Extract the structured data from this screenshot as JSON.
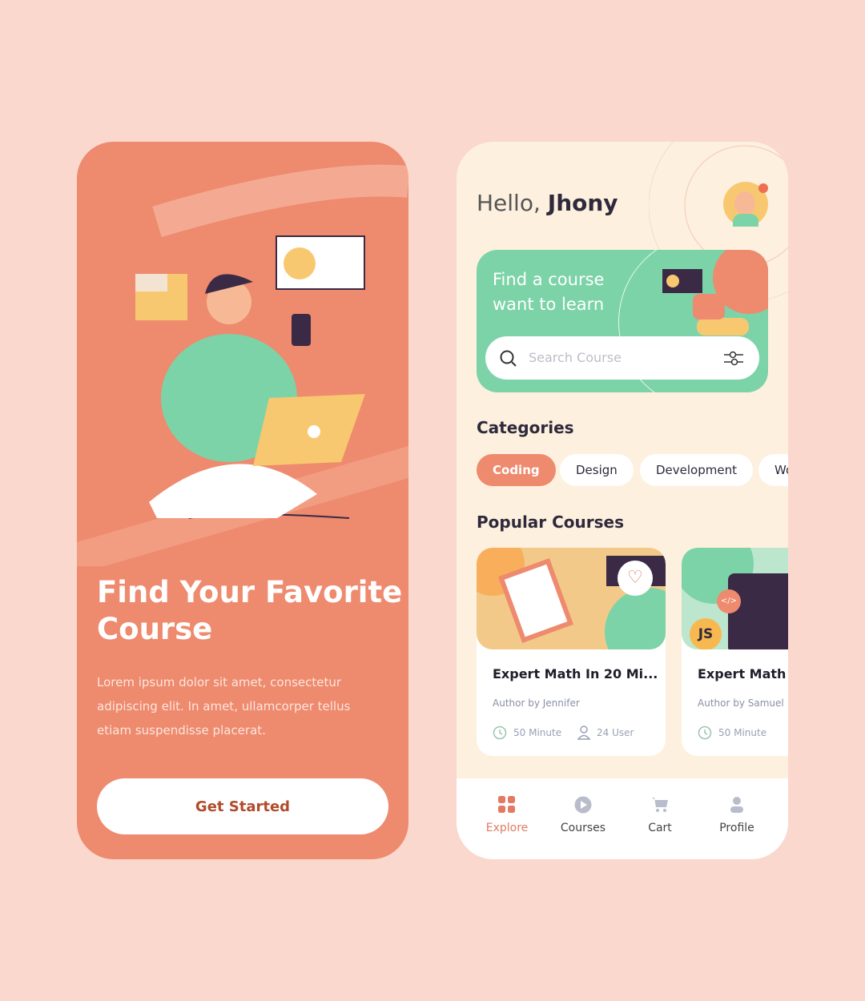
{
  "onboarding": {
    "title": "Find Your Favorite Course",
    "description": "Lorem ipsum dolor sit amet, consectetur adipiscing elit. In amet, ullamcorper tellus etiam suspendisse placerat.",
    "cta": "Get Started"
  },
  "home": {
    "greeting": "Hello,",
    "user_name": "Jhony",
    "banner": {
      "title": "Find a course want to learn",
      "search_placeholder": "Search Course"
    },
    "categories_title": "Categories",
    "categories": [
      {
        "label": "Coding",
        "active": true
      },
      {
        "label": "Design"
      },
      {
        "label": "Development"
      },
      {
        "label": "Wo"
      }
    ],
    "popular_title": "Popular Courses",
    "courses": [
      {
        "title": "Expert Math In 20 Mi...",
        "author": "Author by Jennifer",
        "duration": "50 Minute",
        "users": "24 User"
      },
      {
        "title": "Expert Math In",
        "author": "Author by Samuel",
        "duration": "50 Minute",
        "badge": "JS"
      }
    ],
    "nav": [
      {
        "label": "Explore",
        "active": true
      },
      {
        "label": "Courses"
      },
      {
        "label": "Cart"
      },
      {
        "label": "Profile"
      }
    ]
  },
  "colors": {
    "background": "#FAD8CE",
    "primary": "#EE8A6E",
    "green": "#7DD3A8",
    "cream": "#FDF0DF"
  }
}
